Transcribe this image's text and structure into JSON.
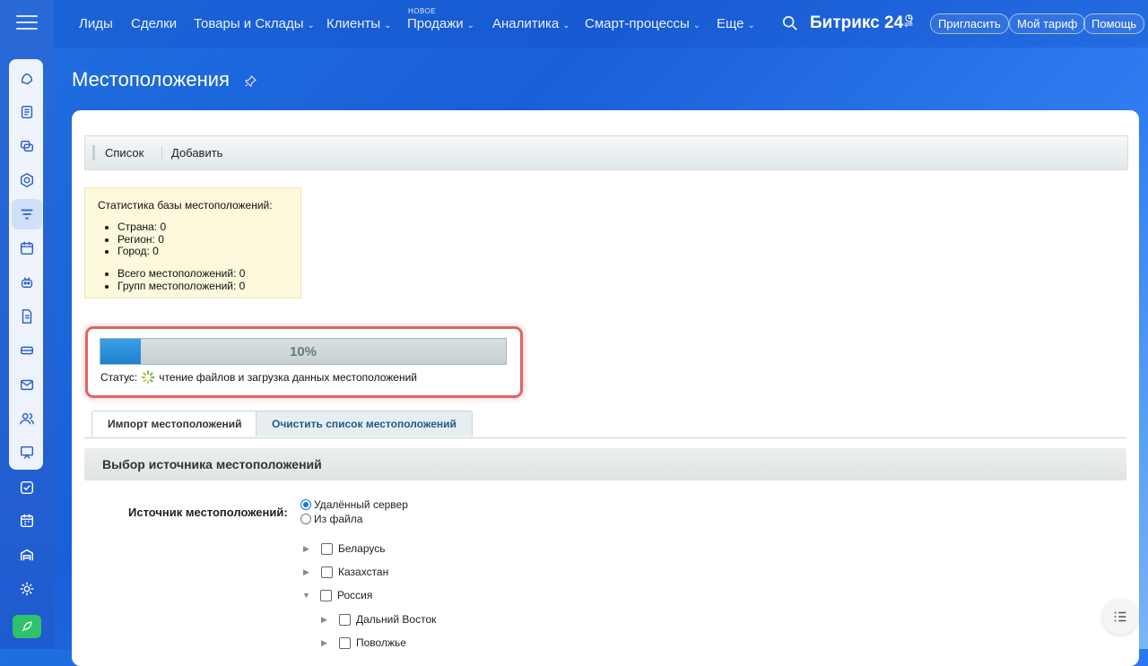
{
  "topnav": {
    "items": [
      {
        "label": "Лиды",
        "chevron": false
      },
      {
        "label": "Сделки",
        "chevron": false
      },
      {
        "label": "Товары и Склады",
        "chevron": true
      },
      {
        "label": "Клиенты",
        "chevron": true
      },
      {
        "label": "Продажи",
        "chevron": true
      },
      {
        "label": "Аналитика",
        "chevron": true
      },
      {
        "label": "Смарт-процессы",
        "chevron": true
      },
      {
        "label": "Еще",
        "chevron": true
      }
    ],
    "new_badge": "НОВОЕ",
    "brand": "Битрикс 24",
    "invite_label": "Пригласить",
    "tariff_label": "Мой тариф",
    "help_label": "Помощь"
  },
  "page": {
    "title": "Местоположения"
  },
  "toolbar": {
    "list_label": "Список",
    "add_label": "Добавить"
  },
  "stats": {
    "heading": "Статистика базы местоположений:",
    "group1": [
      "Страна: 0",
      "Регион: 0",
      "Город: 0"
    ],
    "group2": [
      "Всего местоположений: 0",
      "Групп местоположений: 0"
    ]
  },
  "progress": {
    "percent": 10,
    "percent_label": "10%",
    "status_label": "Статус:",
    "status_text": "чтение файлов и загрузка данных местоположений"
  },
  "tabs": [
    {
      "label": "Импорт местоположений",
      "active": true
    },
    {
      "label": "Очистить список местоположений",
      "active": false
    }
  ],
  "section": {
    "heading": "Выбор источника местоположений",
    "source_label": "Источник местоположений:",
    "options": [
      {
        "label": "Удалённый сервер",
        "selected": true
      },
      {
        "label": "Из файла",
        "selected": false
      }
    ]
  },
  "tree": [
    {
      "label": "Беларусь",
      "expanded": false,
      "level": 0
    },
    {
      "label": "Казахстан",
      "expanded": false,
      "level": 0
    },
    {
      "label": "Россия",
      "expanded": true,
      "level": 0
    },
    {
      "label": "Дальний Восток",
      "expanded": false,
      "level": 1
    },
    {
      "label": "Поволжье",
      "expanded": false,
      "level": 1
    }
  ],
  "colors": {
    "accent": "#1f6fe0",
    "highlight_border": "#e06464",
    "progress_fill": "#1f80cf",
    "stats_bg": "#fdf9dd"
  }
}
